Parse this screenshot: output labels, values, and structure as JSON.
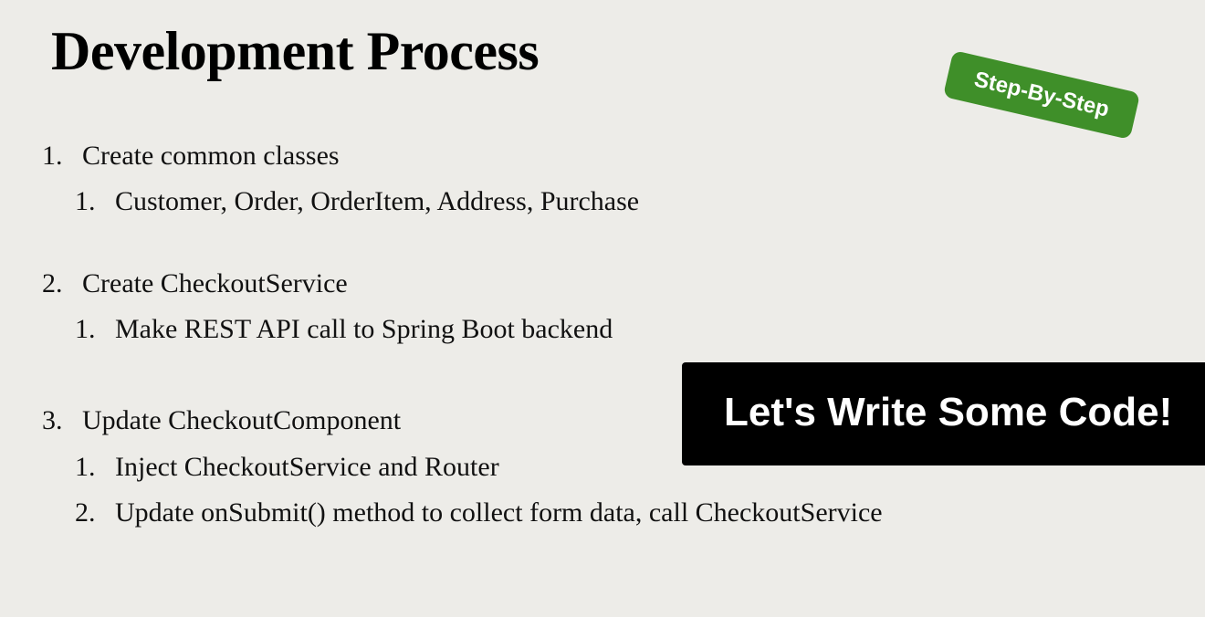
{
  "slide": {
    "title": "Development Process",
    "badge_label": "Step-By-Step",
    "banner_label": "Let's Write Some Code!"
  },
  "steps": [
    {
      "number": "1.",
      "label": "Create common classes",
      "substeps": [
        {
          "number": "1.",
          "label": "Customer, Order, OrderItem, Address, Purchase"
        }
      ]
    },
    {
      "number": "2.",
      "label": "Create CheckoutService",
      "substeps": [
        {
          "number": "1.",
          "label": "Make REST API call to Spring Boot backend"
        }
      ]
    },
    {
      "number": "3.",
      "label": "Update CheckoutComponent",
      "substeps": [
        {
          "number": "1.",
          "label": "Inject CheckoutService and Router"
        },
        {
          "number": "2.",
          "label": "Update onSubmit() method to collect form data, call CheckoutService"
        }
      ]
    }
  ],
  "colors": {
    "background": "#edece8",
    "badge": "#3f8f29",
    "banner": "#000000"
  }
}
